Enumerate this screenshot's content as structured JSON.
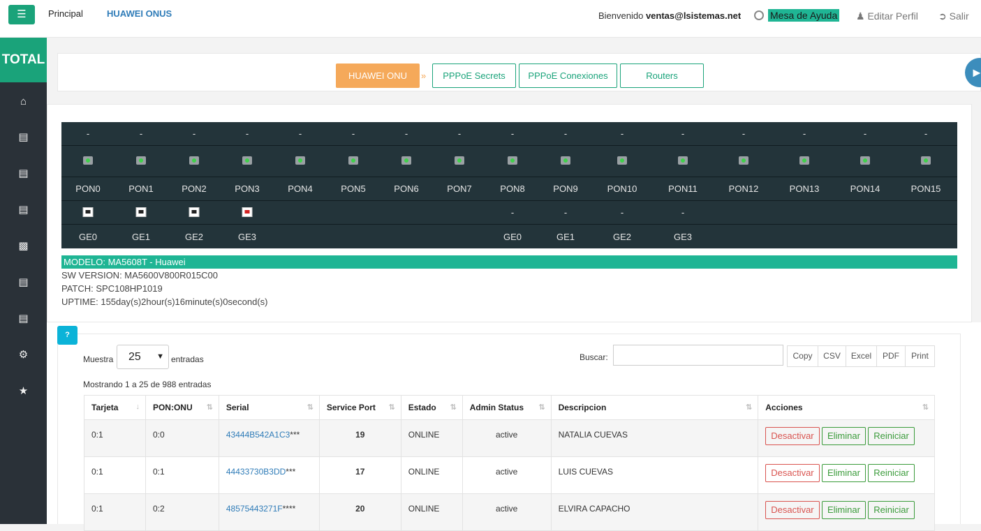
{
  "topbar": {
    "menu_icon": "hamburger-icon",
    "nav": [
      "Principal",
      "HUAWEI ONUS"
    ],
    "welcome_prefix": "Bienvenido",
    "welcome_user": "ventas@lsistemas.net",
    "help": "Mesa de Ayuda",
    "edit_profile": "Editar Perfil",
    "logout": "Salir"
  },
  "sidebar": {
    "brand": "TOTAL",
    "icons": [
      "home-icon",
      "server-icon",
      "server-icon",
      "server-icon",
      "bar-chart-icon",
      "server-icon",
      "server-icon",
      "gear-icon",
      "star-icon"
    ]
  },
  "steps": [
    "HUAWEI ONU",
    "PPPoE Secrets",
    "PPPoE Conexiones",
    "Routers"
  ],
  "pon": {
    "status": [
      "-",
      "-",
      "-",
      "-",
      "-",
      "-",
      "-",
      "-",
      "-",
      "-",
      "-",
      "-",
      "-",
      "-",
      "-",
      "-"
    ],
    "labels": [
      "PON0",
      "PON1",
      "PON2",
      "PON3",
      "PON4",
      "PON5",
      "PON6",
      "PON7",
      "PON8",
      "PON9",
      "PON10",
      "PON11",
      "PON12",
      "PON13",
      "PON14",
      "PON15"
    ],
    "ge_top": [
      "ethernet-up-icon",
      "ethernet-up-icon",
      "ethernet-up-icon",
      "ethernet-down-icon",
      "",
      "",
      "",
      "",
      "-",
      "-",
      "-",
      "-"
    ],
    "ge_labels": [
      "GE0",
      "GE1",
      "GE2",
      "GE3",
      "",
      "",
      "",
      "",
      "GE0",
      "GE1",
      "GE2",
      "GE3"
    ]
  },
  "device": {
    "model": "MODELO: MA5608T - Huawei",
    "sw": "SW VERSION: MA5600V800R015C00",
    "patch": "PATCH: SPC108HP1019",
    "uptime": "UPTIME: 155day(s)2hour(s)16minute(s)0second(s)"
  },
  "table_ctrl": {
    "show": "Muestra",
    "page_size": "25",
    "entries": "entradas",
    "search": "Buscar:",
    "info": "Mostrando 1 a 25 de 988 entradas",
    "exports": [
      "Copy",
      "CSV",
      "Excel",
      "PDF",
      "Print"
    ]
  },
  "table": {
    "headers": [
      "Tarjeta",
      "PON:ONU",
      "Serial",
      "Service Port",
      "Estado",
      "Admin Status",
      "Descripcion",
      "Acciones"
    ],
    "rows": [
      {
        "tarjeta": "0:1",
        "pon_onu": "0:0",
        "serial": "43444B542A1C3",
        "mask": "***",
        "sp": "19",
        "estado": "ONLINE",
        "admin": "active",
        "desc": "NATALIA CUEVAS"
      },
      {
        "tarjeta": "0:1",
        "pon_onu": "0:1",
        "serial": "44433730B3DD",
        "mask": "***",
        "sp": "17",
        "estado": "ONLINE",
        "admin": "active",
        "desc": "LUIS CUEVAS"
      },
      {
        "tarjeta": "0:1",
        "pon_onu": "0:2",
        "serial": "48575443271F",
        "mask": "****",
        "sp": "20",
        "estado": "ONLINE",
        "admin": "active",
        "desc": "ELVIRA CAPACHO"
      }
    ],
    "actions": [
      "Desactivar",
      "Eliminar",
      "Reiniciar"
    ]
  }
}
